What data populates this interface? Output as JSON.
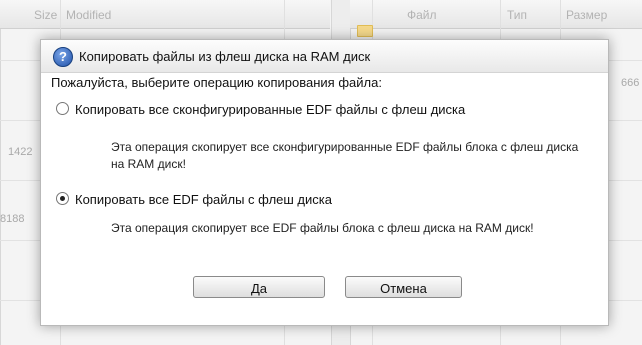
{
  "background": {
    "left_columns": [
      "Size",
      "Modified"
    ],
    "right_columns": [
      "Файл",
      "Тип",
      "Размер"
    ],
    "partial_numbers": [
      "1422",
      "8188",
      "666"
    ]
  },
  "dialog": {
    "title": "Копировать файлы из флеш диска на RAM диск",
    "prompt": "Пожалуйста, выберите операцию копирования файла:",
    "options": [
      {
        "label": "Копировать все сконфигурированные EDF файлы с флеш диска",
        "description": "Эта операция скопирует все сконфигурированные  EDF файлы блока с флеш диска на RAM диск!",
        "selected": false
      },
      {
        "label": "Копировать все EDF файлы с флеш диска",
        "description": "Эта операция скопирует все EDF файлы блока с флеш диска на RAM диск!",
        "selected": true
      }
    ],
    "buttons": {
      "ok": "Да",
      "cancel": "Отмена"
    }
  }
}
